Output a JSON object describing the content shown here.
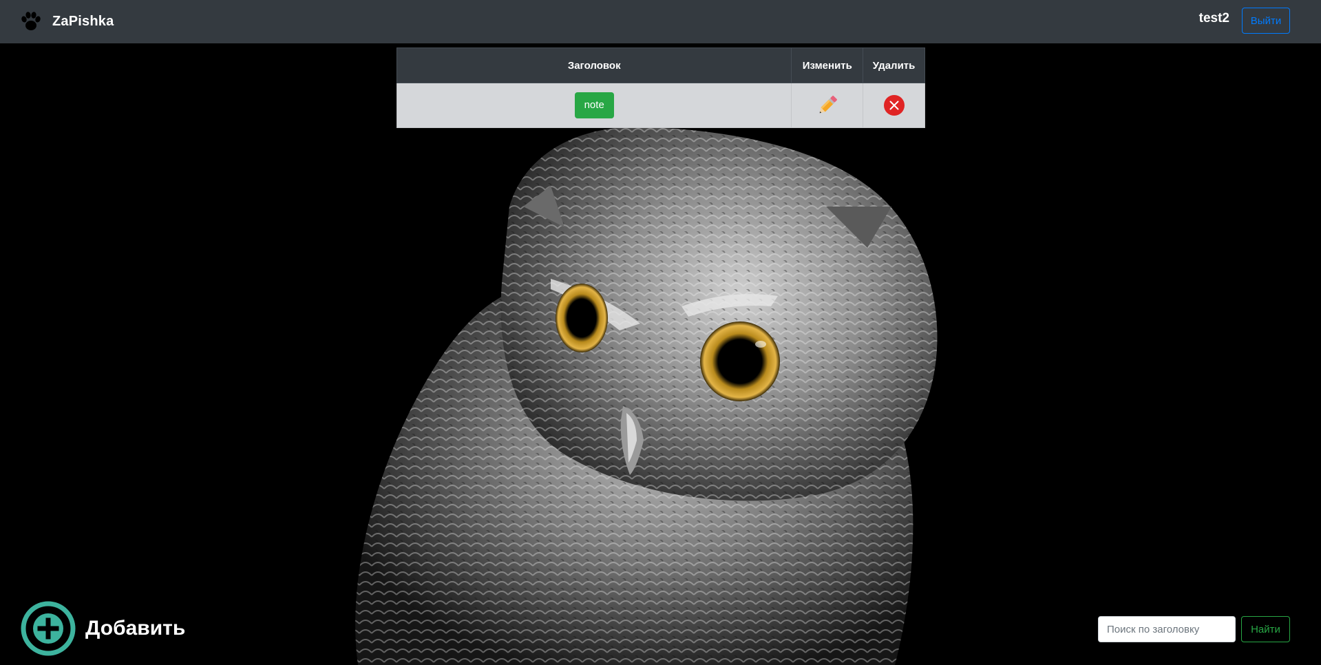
{
  "navbar": {
    "brand_name": "ZaPishka",
    "brand_icon": "paw-icon",
    "username": "test2",
    "logout_label": "Выйти",
    "logout_color": "#007bff",
    "background_color": "#343a40"
  },
  "table": {
    "headers": {
      "title": "Заголовок",
      "edit": "Изменить",
      "delete": "Удалить"
    },
    "rows": [
      {
        "title": "note",
        "edit_icon": "pencil-icon",
        "delete_icon": "close-circle-icon"
      }
    ]
  },
  "add": {
    "label": "Добавить",
    "icon": "plus-circle-icon",
    "icon_color": "#3db39e"
  },
  "search": {
    "placeholder": "Поиск по заголовку",
    "value": "",
    "button_label": "Найти",
    "button_color": "#28a745"
  },
  "background": {
    "image": "owl-photo",
    "color": "#000000"
  }
}
